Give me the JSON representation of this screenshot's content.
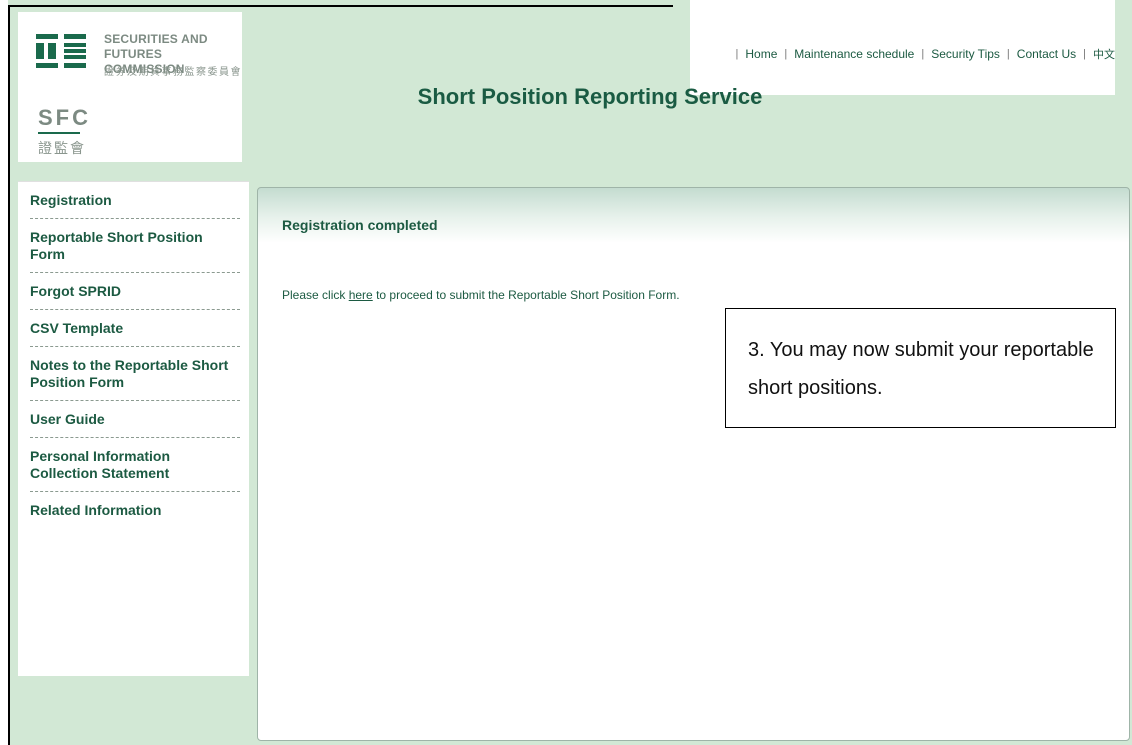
{
  "logo": {
    "org_en_line1": "SECURITIES AND",
    "org_en_line2": "FUTURES COMMISSION",
    "org_zh": "證券及期貨事務監察委員會",
    "abbr": "SFC",
    "abbr_zh": "證監會"
  },
  "topnav": {
    "items": [
      {
        "label": "Home"
      },
      {
        "label": "Maintenance schedule"
      },
      {
        "label": "Security Tips"
      },
      {
        "label": "Contact Us"
      },
      {
        "label": "中文"
      }
    ],
    "separator": "|"
  },
  "header": {
    "title": "Short Position Reporting Service"
  },
  "sidebar": {
    "items": [
      {
        "label": "Registration"
      },
      {
        "label": "Reportable Short Position Form"
      },
      {
        "label": "Forgot SPRID"
      },
      {
        "label": "CSV Template"
      },
      {
        "label": "Notes to the Reportable Short Position Form"
      },
      {
        "label": "User Guide"
      },
      {
        "label": "Personal Information Collection Statement"
      },
      {
        "label": "Related Information"
      }
    ]
  },
  "main": {
    "heading": "Registration completed",
    "text_before": "Please click ",
    "link_label": "here",
    "text_after": " to proceed to submit the Reportable Short Position Form."
  },
  "callout": {
    "text": "3. You may now submit your reportable short positions."
  },
  "colors": {
    "page_background": "#d2e8d5",
    "brand_green": "#1c5a42",
    "logo_mark_green": "#1a6a4c"
  }
}
